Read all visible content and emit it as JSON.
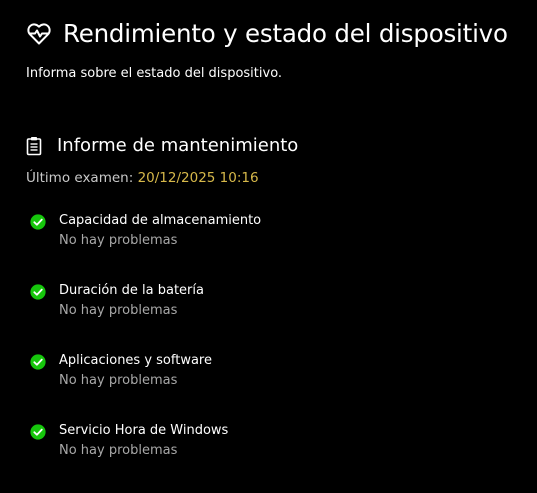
{
  "header": {
    "icon": "heart-pulse-icon",
    "title": "Rendimiento y estado del dispositivo",
    "subtitle": "Informa sobre el estado del dispositivo."
  },
  "report": {
    "icon": "clipboard-icon",
    "title": "Informe de mantenimiento",
    "last_scan_label": "Último examen:",
    "last_scan_value": "20/12/2025 10:16",
    "items": [
      {
        "icon": "check-circle-icon",
        "title": "Capacidad de almacenamiento",
        "status": "No hay problemas"
      },
      {
        "icon": "check-circle-icon",
        "title": "Duración de la batería",
        "status": "No hay problemas"
      },
      {
        "icon": "check-circle-icon",
        "title": "Aplicaciones y software",
        "status": "No hay problemas"
      },
      {
        "icon": "check-circle-icon",
        "title": "Servicio Hora de Windows",
        "status": "No hay problemas"
      }
    ]
  },
  "colors": {
    "background": "#000000",
    "text": "#ffffff",
    "secondary_text": "#a8a8a8",
    "timestamp": "#d6b84a",
    "ok_green": "#16c60c"
  }
}
